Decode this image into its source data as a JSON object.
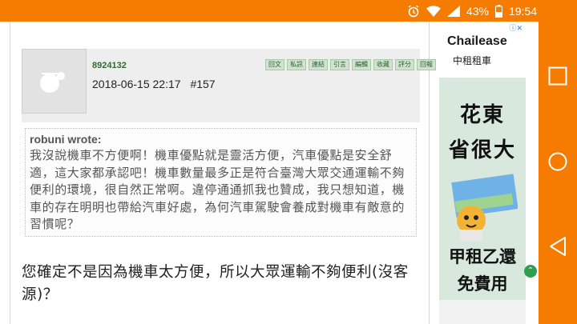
{
  "status_bar": {
    "battery": "43%",
    "time": "19:54",
    "background": "#f57c00"
  },
  "post": {
    "username": "8924132",
    "datetime": "2018-06-15 22:17",
    "post_number": "#157",
    "actions": [
      "回文",
      "私訊",
      "連結",
      "引言",
      "編輯",
      "收藏",
      "評分",
      "回報"
    ],
    "quote": {
      "author": "robuni wrote:",
      "body": "我沒說機車不方便啊！機車優點就是靈活方便，汽車優點是安全舒適，這大家都承認吧！機車數量最多正是符合臺灣大眾交通運輸不夠便利的環境，很自然正常啊。違停通通抓我也贊成，我只想知道，機車的存在明明也帶給汽車好處，為何汽車駕駛會養成對機車有敵意的習慣呢？"
    },
    "reply": "您確定不是因為機車太方便，所以大眾運輸不夠便利(沒客源)？"
  },
  "ad": {
    "brand": "Chailease",
    "brand_chinese": "中租租車",
    "line1": "花東",
    "line2": "省很大",
    "line3": "甲租乙還",
    "line4": "免費用"
  },
  "nav": {
    "icons": [
      "square-icon",
      "circle-icon",
      "triangle-back-icon"
    ]
  }
}
